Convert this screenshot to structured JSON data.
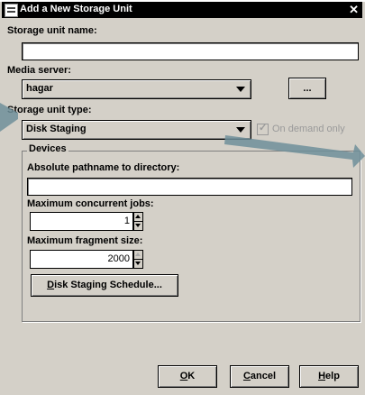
{
  "window": {
    "title": "Add a New Storage Unit",
    "close": "✕"
  },
  "form": {
    "storage_unit_name_label": "Storage unit name:",
    "storage_unit_name_value": "",
    "media_server_label": "Media server:",
    "media_server_value": "hagar",
    "browse_button": "...",
    "storage_unit_type_label": "Storage unit type:",
    "storage_unit_type_value": "Disk Staging",
    "on_demand_label": "On demand only",
    "on_demand_checked": true
  },
  "devices": {
    "group_title": "Devices",
    "path_label": "Absolute pathname to directory:",
    "path_value": "",
    "max_jobs_label": "Maximum concurrent jobs:",
    "max_jobs_value": "1",
    "max_fragment_label": "Maximum fragment size:",
    "max_fragment_value": "2000",
    "schedule_button": "Disk Staging Schedule..."
  },
  "buttons": {
    "ok": "OK",
    "cancel": "Cancel",
    "help": "Help"
  },
  "colors": {
    "dialog_bg": "#d4d0c8",
    "title_bg": "#000000",
    "arrow": "#6f8f9a"
  }
}
